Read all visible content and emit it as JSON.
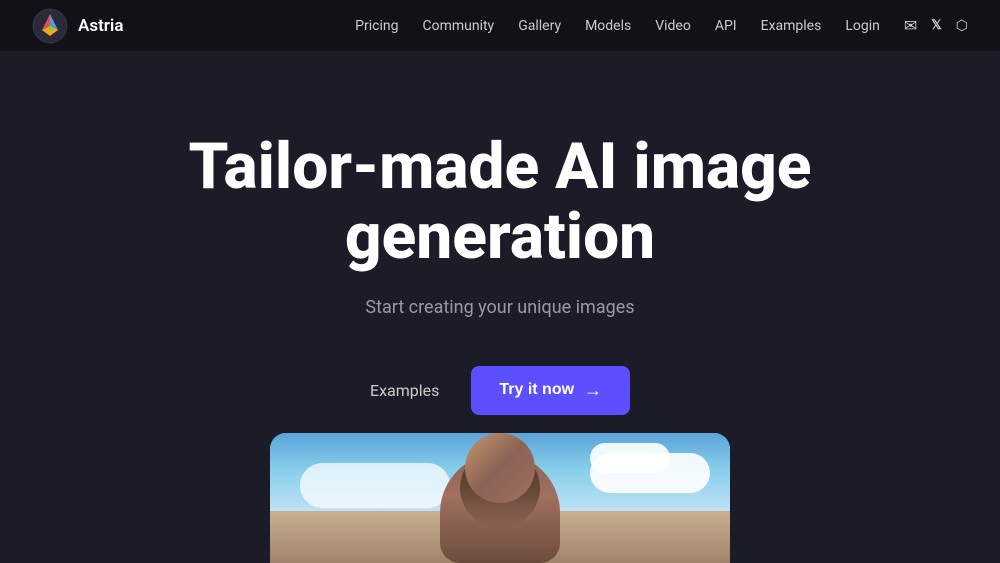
{
  "brand": {
    "name": "Astria"
  },
  "navbar": {
    "links": [
      {
        "label": "Pricing",
        "id": "pricing"
      },
      {
        "label": "Community",
        "id": "community"
      },
      {
        "label": "Gallery",
        "id": "gallery"
      },
      {
        "label": "Models",
        "id": "models"
      },
      {
        "label": "Video",
        "id": "video"
      },
      {
        "label": "API",
        "id": "api"
      },
      {
        "label": "Examples",
        "id": "examples"
      },
      {
        "label": "Login",
        "id": "login"
      }
    ],
    "icons": [
      {
        "name": "email-icon",
        "symbol": "✉"
      },
      {
        "name": "twitter-icon",
        "symbol": "𝕏"
      },
      {
        "name": "discord-icon",
        "symbol": "⊞"
      }
    ]
  },
  "hero": {
    "title": "Tailor-made AI image generation",
    "subtitle": "Start creating your unique images",
    "examples_label": "Examples",
    "cta_label": "Try it now",
    "cta_arrow": "→"
  }
}
